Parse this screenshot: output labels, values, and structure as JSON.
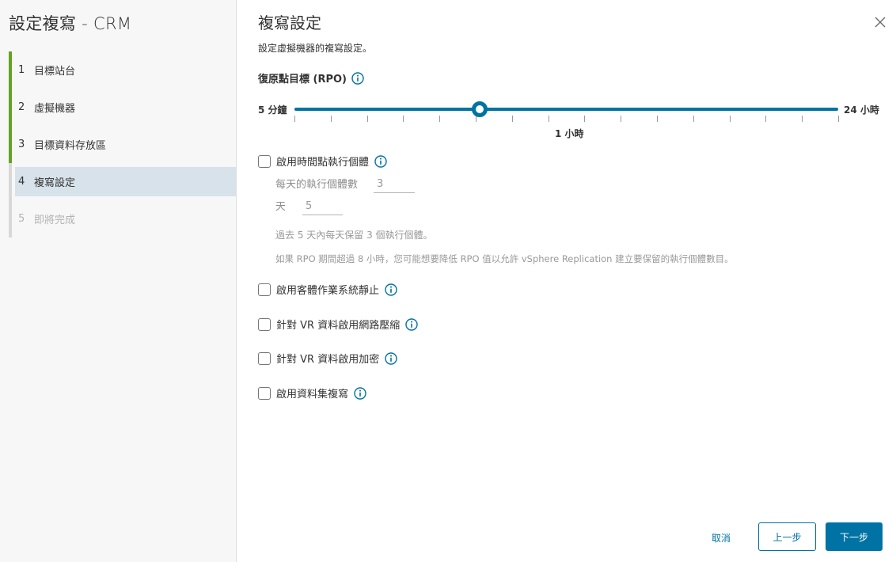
{
  "sidebar": {
    "title": "設定複寫 - CRM",
    "steps": [
      {
        "num": "1",
        "label": "目標站台"
      },
      {
        "num": "2",
        "label": "虛擬機器"
      },
      {
        "num": "3",
        "label": "目標資料存放區"
      },
      {
        "num": "4",
        "label": "複寫設定"
      },
      {
        "num": "5",
        "label": "即將完成"
      }
    ]
  },
  "main": {
    "title": "複寫設定",
    "subtitle": "設定虛擬機器的複寫設定。",
    "rpo": {
      "label": "復原點目標 (RPO)",
      "min_label": "5 分鐘",
      "max_label": "24 小時",
      "value_label": "1 小時",
      "value_fraction": 0.34
    },
    "pit": {
      "label": "啟用時間點執行個體",
      "instances_label": "每天的執行個體數",
      "instances_value": "3",
      "days_label": "天",
      "days_value": "5",
      "hint1": "過去 5 天內每天保留 3 個執行個體。",
      "hint2": "如果 RPO 期間超過 8 小時，您可能想要降低 RPO 值以允許 vSphere Replication 建立要保留的執行個體數目。"
    },
    "options": {
      "quiescing": "啟用客體作業系統靜止",
      "compression": "針對 VR 資料啟用網路壓縮",
      "encryption": "針對 VR 資料啟用加密",
      "datasets": "啟用資料集複寫"
    }
  },
  "footer": {
    "cancel": "取消",
    "back": "上一步",
    "next": "下一步"
  },
  "colors": {
    "accent": "#0072a3",
    "done_step": "#62a420",
    "current_step_bg": "#d7e2ea"
  }
}
